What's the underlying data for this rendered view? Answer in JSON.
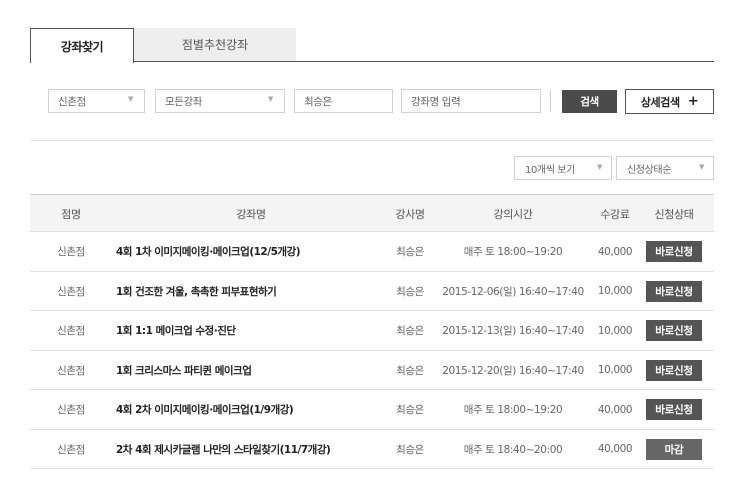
{
  "tabs": [
    {
      "label": "강좌찾기",
      "active": true
    },
    {
      "label": "점별추천강좌",
      "active": false
    }
  ],
  "filters": {
    "branch": "신촌점",
    "course_type": "모든강좌",
    "teacher": "최승은",
    "course_name_placeholder": "강좌명 입력",
    "search_label": "검색",
    "detail_search_label": "상세검색",
    "detail_plus": "+"
  },
  "list_options": {
    "page_size": "10개씩 보기",
    "sort": "신청상태순"
  },
  "table": {
    "headers": {
      "branch": "점명",
      "title": "강좌명",
      "teacher": "강사명",
      "time": "강의시간",
      "fee": "수강료",
      "status": "신청상태"
    },
    "rows": [
      {
        "branch": "신촌점",
        "title": "4회 1차 이미지메이킹·메이크업(12/5개강)",
        "teacher": "최승은",
        "time": "매주 토 18:00~19:20",
        "fee": "40,000",
        "status": "바로신청",
        "status_type": "open"
      },
      {
        "branch": "신촌점",
        "title": "1회 건조한 겨울, 촉촉한 피부표현하기",
        "teacher": "최승은",
        "time": "2015-12-06(일) 16:40~17:40",
        "fee": "10,000",
        "status": "바로신청",
        "status_type": "open"
      },
      {
        "branch": "신촌점",
        "title": "1회 1:1 메이크업 수정·진단",
        "teacher": "최승은",
        "time": "2015-12-13(일) 16:40~17:40",
        "fee": "10,000",
        "status": "바로신청",
        "status_type": "open"
      },
      {
        "branch": "신촌점",
        "title": "1회 크리스마스 파티퀸 메이크업",
        "teacher": "최승은",
        "time": "2015-12-20(일) 16:40~17:40",
        "fee": "10,000",
        "status": "바로신청",
        "status_type": "open"
      },
      {
        "branch": "신촌점",
        "title": "4회 2차 이미지메이킹·메이크업(1/9개강)",
        "teacher": "최승은",
        "time": "매주 토 18:00~19:20",
        "fee": "40,000",
        "status": "바로신청",
        "status_type": "open"
      },
      {
        "branch": "신촌점",
        "title": "2차 4회 제시카글램 나만의 스타일찾기(11/7개강)",
        "teacher": "최승은",
        "time": "매주 토 18:40~20:00",
        "fee": "40,000",
        "status": "마감",
        "status_type": "closed"
      }
    ]
  },
  "colors": {
    "accent_dark": "#4b4b4b",
    "status_open": "#555555",
    "status_closed": "#666666",
    "header_bg": "#f4f4f4"
  },
  "icons": {
    "dropdown": "chevron-down-icon",
    "plus": "plus-icon"
  }
}
